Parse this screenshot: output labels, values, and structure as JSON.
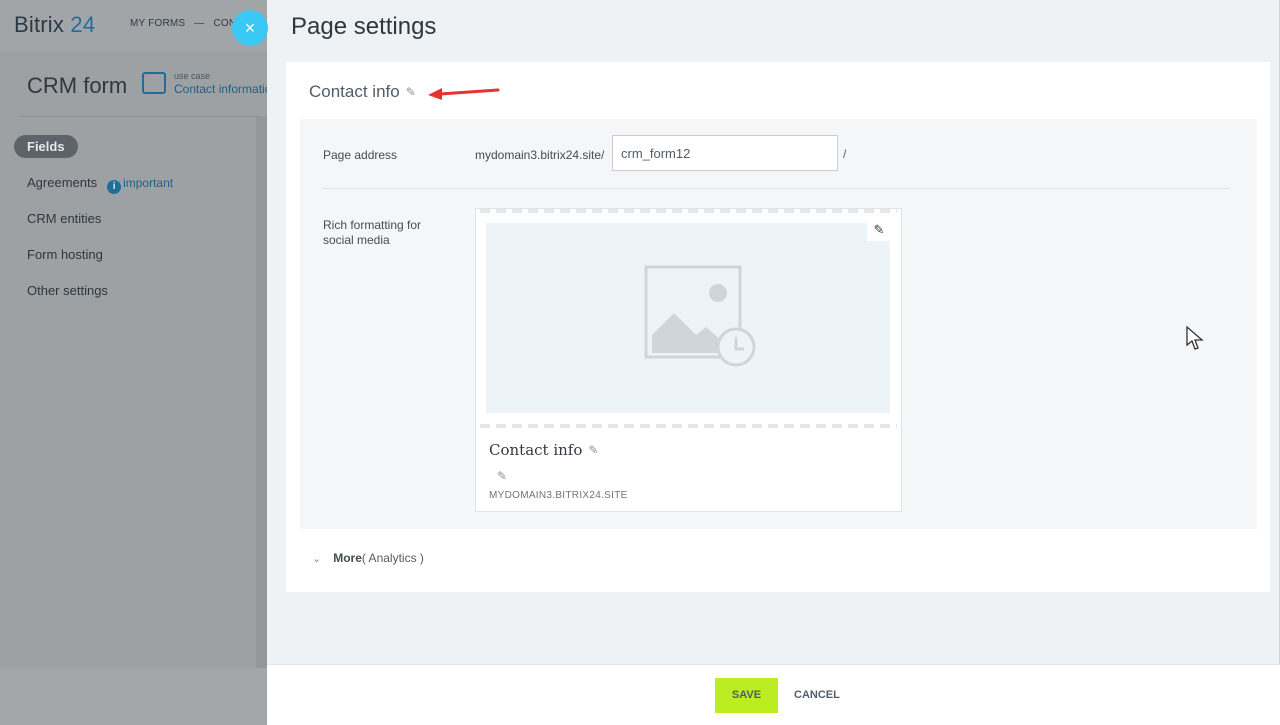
{
  "app": {
    "logo_main": "Bitrix",
    "logo_num": "24",
    "menu": [
      "MY FORMS",
      "—",
      "CON"
    ]
  },
  "background": {
    "title": "CRM form",
    "usecase_label": "use case",
    "usecase_value": "Contact information",
    "nav": [
      {
        "label": "Fields",
        "active": true
      },
      {
        "label": "Agreements",
        "badge": "important"
      },
      {
        "label": "CRM entities"
      },
      {
        "label": "Form hosting"
      },
      {
        "label": "Other settings"
      }
    ]
  },
  "slider": {
    "close_symbol": "×",
    "title": "Page settings",
    "card_title": "Contact info",
    "page_address_label": "Page address",
    "domain": "mydomain3.bitrix24.site/",
    "slug_value": "crm_form12",
    "slash": "/",
    "rich_label": "Rich formatting for social media",
    "preview": {
      "title": "Contact info",
      "domain": "MYDOMAIN3.BITRIX24.SITE"
    },
    "more_label": "More",
    "more_sub": "( Analytics )"
  },
  "footer": {
    "save": "SAVE",
    "cancel": "CANCEL"
  },
  "colors": {
    "accent": "#3bc8f5",
    "save": "#bbed21",
    "arrow": "#e8322f"
  }
}
